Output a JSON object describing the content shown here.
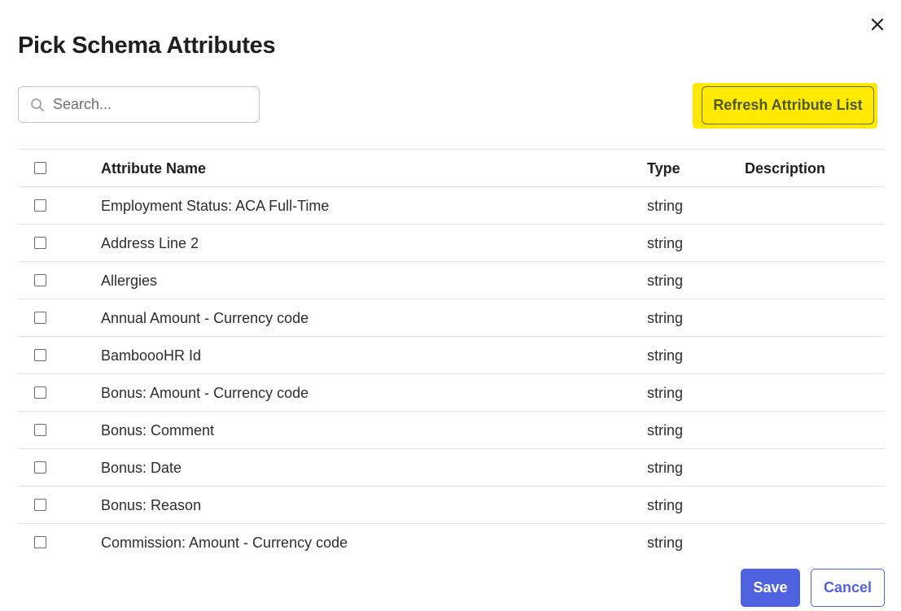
{
  "dialog": {
    "title": "Pick Schema Attributes",
    "close_icon": "close-icon"
  },
  "search": {
    "placeholder": "Search...",
    "value": "",
    "icon": "search-icon"
  },
  "toolbar": {
    "refresh_label": "Refresh Attribute List",
    "highlight_color": "#ffe900"
  },
  "table": {
    "columns": [
      "Attribute Name",
      "Type",
      "Description"
    ],
    "rows": [
      {
        "name": "Employment Status: ACA Full-Time",
        "type": "string",
        "description": ""
      },
      {
        "name": "Address Line 2",
        "type": "string",
        "description": ""
      },
      {
        "name": "Allergies",
        "type": "string",
        "description": ""
      },
      {
        "name": "Annual Amount - Currency code",
        "type": "string",
        "description": ""
      },
      {
        "name": "BamboooHR Id",
        "type": "string",
        "description": ""
      },
      {
        "name": "Bonus: Amount - Currency code",
        "type": "string",
        "description": ""
      },
      {
        "name": "Bonus: Comment",
        "type": "string",
        "description": ""
      },
      {
        "name": "Bonus: Date",
        "type": "string",
        "description": ""
      },
      {
        "name": "Bonus: Reason",
        "type": "string",
        "description": ""
      },
      {
        "name": "Commission: Amount - Currency code",
        "type": "string",
        "description": ""
      }
    ]
  },
  "footer": {
    "save_label": "Save",
    "cancel_label": "Cancel",
    "primary_color": "#4f63e0"
  }
}
